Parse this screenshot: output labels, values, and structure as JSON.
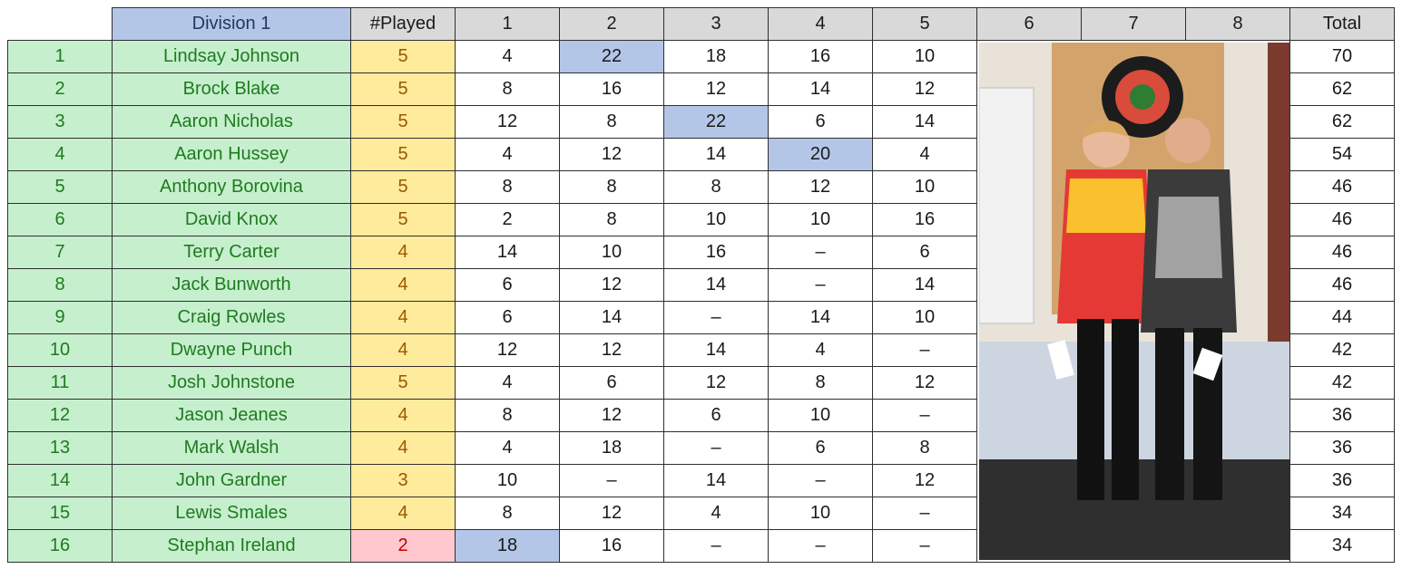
{
  "header": {
    "division": "Division 1",
    "played": "#Played",
    "rounds": [
      "1",
      "2",
      "3",
      "4",
      "5",
      "6",
      "7",
      "8"
    ],
    "total": "Total"
  },
  "rows": [
    {
      "rank": "1",
      "name": "Lindsay Johnson",
      "played": "5",
      "r": [
        "4",
        "22",
        "18",
        "16",
        "10"
      ],
      "total": "70"
    },
    {
      "rank": "2",
      "name": "Brock Blake",
      "played": "5",
      "r": [
        "8",
        "16",
        "12",
        "14",
        "12"
      ],
      "total": "62"
    },
    {
      "rank": "3",
      "name": "Aaron Nicholas",
      "played": "5",
      "r": [
        "12",
        "8",
        "22",
        "6",
        "14"
      ],
      "total": "62"
    },
    {
      "rank": "4",
      "name": "Aaron Hussey",
      "played": "5",
      "r": [
        "4",
        "12",
        "14",
        "20",
        "4"
      ],
      "total": "54"
    },
    {
      "rank": "5",
      "name": "Anthony Borovina",
      "played": "5",
      "r": [
        "8",
        "8",
        "8",
        "12",
        "10"
      ],
      "total": "46"
    },
    {
      "rank": "6",
      "name": "David Knox",
      "played": "5",
      "r": [
        "2",
        "8",
        "10",
        "10",
        "16"
      ],
      "total": "46"
    },
    {
      "rank": "7",
      "name": "Terry Carter",
      "played": "4",
      "r": [
        "14",
        "10",
        "16",
        "–",
        "6"
      ],
      "total": "46"
    },
    {
      "rank": "8",
      "name": "Jack Bunworth",
      "played": "4",
      "r": [
        "6",
        "12",
        "14",
        "–",
        "14"
      ],
      "total": "46"
    },
    {
      "rank": "9",
      "name": "Craig Rowles",
      "played": "4",
      "r": [
        "6",
        "14",
        "–",
        "14",
        "10"
      ],
      "total": "44"
    },
    {
      "rank": "10",
      "name": "Dwayne Punch",
      "played": "4",
      "r": [
        "12",
        "12",
        "14",
        "4",
        "–"
      ],
      "total": "42"
    },
    {
      "rank": "11",
      "name": "Josh Johnstone",
      "played": "5",
      "r": [
        "4",
        "6",
        "12",
        "8",
        "12"
      ],
      "total": "42"
    },
    {
      "rank": "12",
      "name": "Jason Jeanes",
      "played": "4",
      "r": [
        "8",
        "12",
        "6",
        "10",
        "–"
      ],
      "total": "36"
    },
    {
      "rank": "13",
      "name": "Mark Walsh",
      "played": "4",
      "r": [
        "4",
        "18",
        "–",
        "6",
        "8"
      ],
      "total": "36"
    },
    {
      "rank": "14",
      "name": "John Gardner",
      "played": "3",
      "r": [
        "10",
        "–",
        "14",
        "–",
        "12"
      ],
      "total": "36"
    },
    {
      "rank": "15",
      "name": "Lewis Smales",
      "played": "4",
      "r": [
        "8",
        "12",
        "4",
        "10",
        "–"
      ],
      "total": "34"
    },
    {
      "rank": "16",
      "name": "Stephan Ireland",
      "played": "2",
      "r": [
        "18",
        "16",
        "–",
        "–",
        "–"
      ],
      "total": "34"
    }
  ],
  "highlights": [
    [
      0,
      1
    ],
    [
      2,
      2
    ],
    [
      3,
      3
    ],
    [
      15,
      0
    ]
  ],
  "low_played_rows": [
    15
  ],
  "colors": {
    "header_blue": "#b4c6e7",
    "header_gray": "#d9d9d9",
    "green_fill": "#c6efce",
    "green_text": "#1e7b1e",
    "yellow_fill": "#ffeb9c",
    "yellow_text": "#9c5700",
    "red_fill": "#ffc7ce",
    "red_text": "#c00000"
  },
  "photo": {
    "icon": "two-players-photo"
  }
}
